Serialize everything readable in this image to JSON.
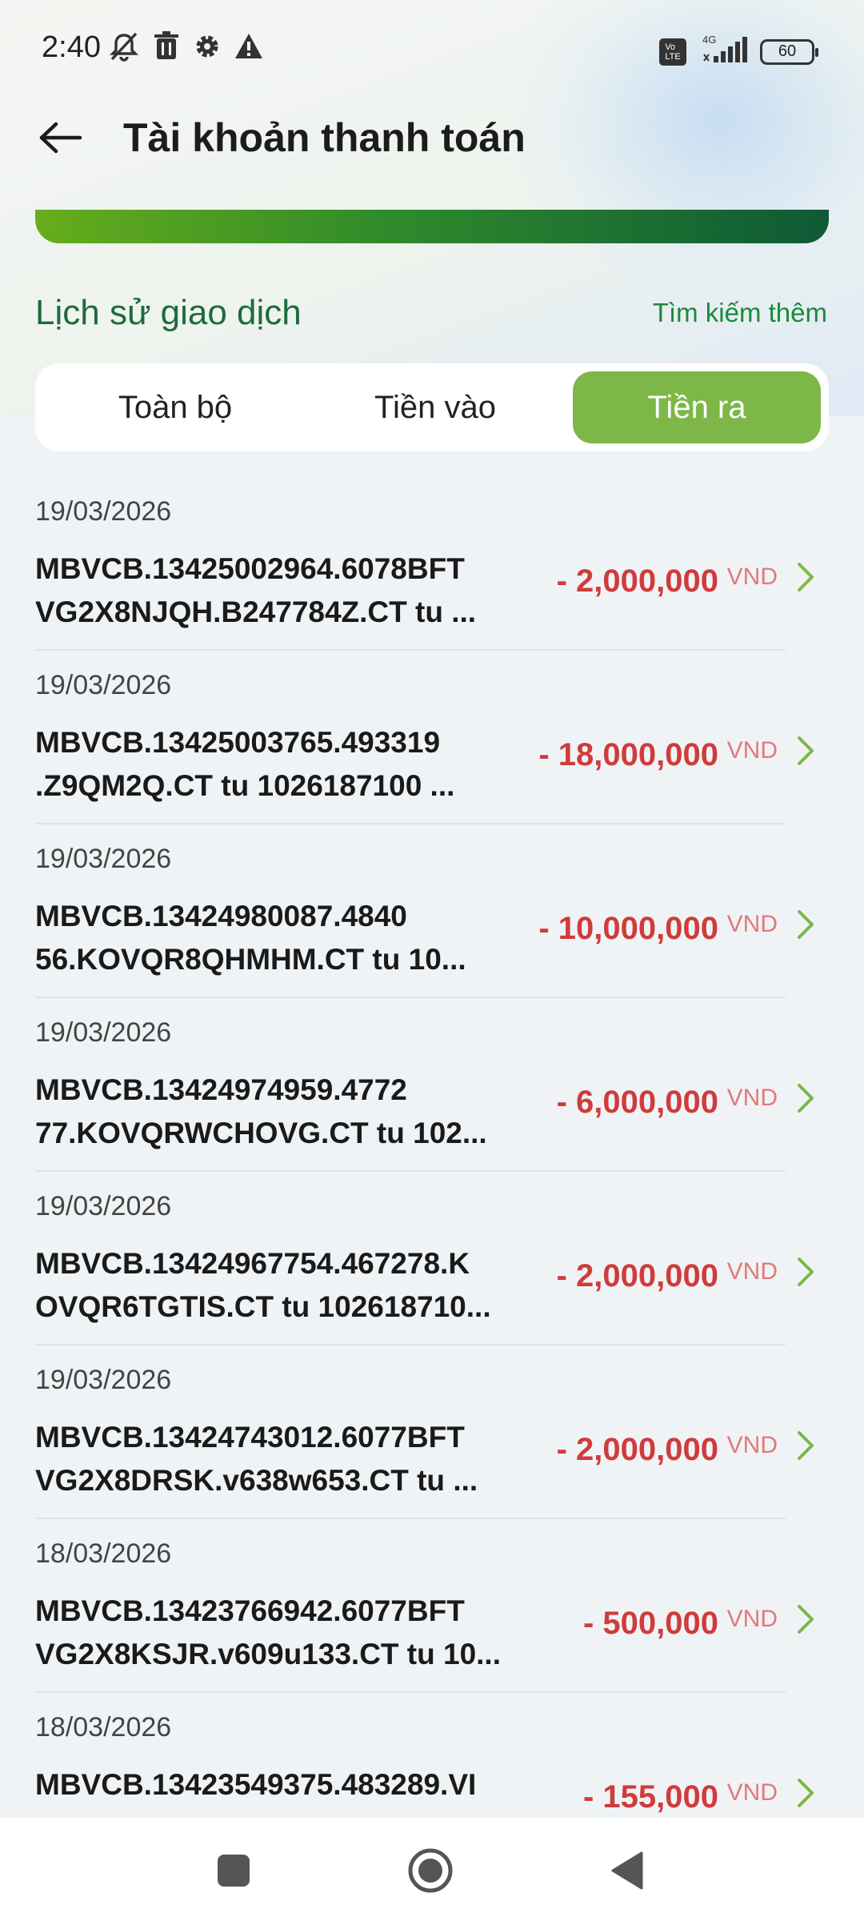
{
  "status_bar": {
    "time": "2:40",
    "network": "4G",
    "volte": "Vo LTE",
    "battery": "60"
  },
  "header": {
    "title": "Tài khoản thanh toán"
  },
  "section": {
    "title": "Lịch sử giao dịch",
    "search_more": "Tìm kiếm thêm"
  },
  "tabs": [
    {
      "label": "Toàn bộ",
      "active": false
    },
    {
      "label": "Tiền vào",
      "active": false
    },
    {
      "label": "Tiền ra",
      "active": true
    }
  ],
  "transactions": [
    {
      "date": "19/03/2026",
      "line1": "MBVCB.13425002964.6078BFT",
      "line2": "VG2X8NJQH.B247784Z.CT tu ...",
      "amount": "- 2,000,000",
      "currency": "VND"
    },
    {
      "date": "19/03/2026",
      "line1": "MBVCB.13425003765.493319",
      "line2": ".Z9QM2Q.CT tu 1026187100 ...",
      "amount": "- 18,000,000",
      "currency": "VND"
    },
    {
      "date": "19/03/2026",
      "line1": "MBVCB.13424980087.4840",
      "line2": "56.KOVQR8QHMHM.CT tu 10...",
      "amount": "- 10,000,000",
      "currency": "VND"
    },
    {
      "date": "19/03/2026",
      "line1": "MBVCB.13424974959.4772",
      "line2": "77.KOVQRWCHOVG.CT tu 102...",
      "amount": "- 6,000,000",
      "currency": "VND"
    },
    {
      "date": "19/03/2026",
      "line1": "MBVCB.13424967754.467278.K",
      "line2": "OVQR6TGTIS.CT tu 102618710...",
      "amount": "- 2,000,000",
      "currency": "VND"
    },
    {
      "date": "19/03/2026",
      "line1": "MBVCB.13424743012.6077BFT",
      "line2": "VG2X8DRSK.v638w653.CT tu ...",
      "amount": "- 2,000,000",
      "currency": "VND"
    },
    {
      "date": "18/03/2026",
      "line1": "MBVCB.13423766942.6077BFT",
      "line2": "VG2X8KSJR.v609u133.CT tu 10...",
      "amount": "- 500,000",
      "currency": "VND"
    },
    {
      "date": "18/03/2026",
      "line1": "MBVCB.13423549375.483289.VI",
      "line2": "",
      "amount": "- 155,000",
      "currency": "VND"
    }
  ],
  "colors": {
    "accent_green": "#7db748",
    "title_green": "#1e6b3b",
    "amount_red": "#d03b3b"
  }
}
